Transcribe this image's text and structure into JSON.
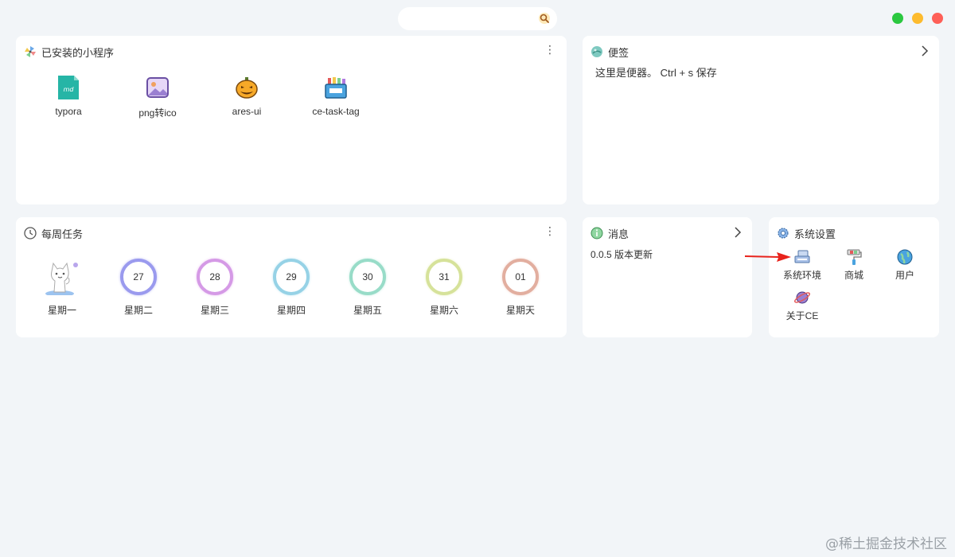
{
  "window": {
    "controls": {
      "green": "#2bc840",
      "yellow": "#fdbb2e",
      "red": "#fe5f57"
    }
  },
  "search": {
    "icon": "search-icon"
  },
  "installed_apps": {
    "title": "已安装的小程序",
    "icon": "pinwheel-icon",
    "items": [
      {
        "label": "typora",
        "icon": "markdown-file-icon"
      },
      {
        "label": "png转ico",
        "icon": "image-icon"
      },
      {
        "label": "ares-ui",
        "icon": "pumpkin-icon"
      },
      {
        "label": "ce-task-tag",
        "icon": "crayon-box-icon"
      }
    ]
  },
  "notes": {
    "title": "便签",
    "icon": "note-ball-icon",
    "content": "这里是便器。 Ctrl + s 保存"
  },
  "weekly_tasks": {
    "title": "每周任务",
    "icon": "clock-icon",
    "days": [
      {
        "label": "星期一",
        "date": "",
        "avatar": "cat-avatar-icon"
      },
      {
        "label": "星期二",
        "date": "27",
        "color": "#8f8fe8"
      },
      {
        "label": "星期三",
        "date": "28",
        "color": "#d28fe0"
      },
      {
        "label": "星期四",
        "date": "29",
        "color": "#8fcfe0"
      },
      {
        "label": "星期五",
        "date": "30",
        "color": "#8fdcc4"
      },
      {
        "label": "星期六",
        "date": "31",
        "color": "#d4e08f"
      },
      {
        "label": "星期天",
        "date": "01",
        "color": "#e0a89f"
      }
    ]
  },
  "messages": {
    "title": "消息",
    "icon": "info-icon",
    "content": "0.0.5 版本更新"
  },
  "settings": {
    "title": "系统设置",
    "icon": "gear-icon",
    "items": [
      {
        "label": "系统环境",
        "icon": "computer-icon"
      },
      {
        "label": "商城",
        "icon": "paint-roller-icon"
      },
      {
        "label": "用户",
        "icon": "globe-icon"
      },
      {
        "label": "关于CE",
        "icon": "planet-icon"
      }
    ]
  },
  "watermark": "@稀土掘金技术社区"
}
